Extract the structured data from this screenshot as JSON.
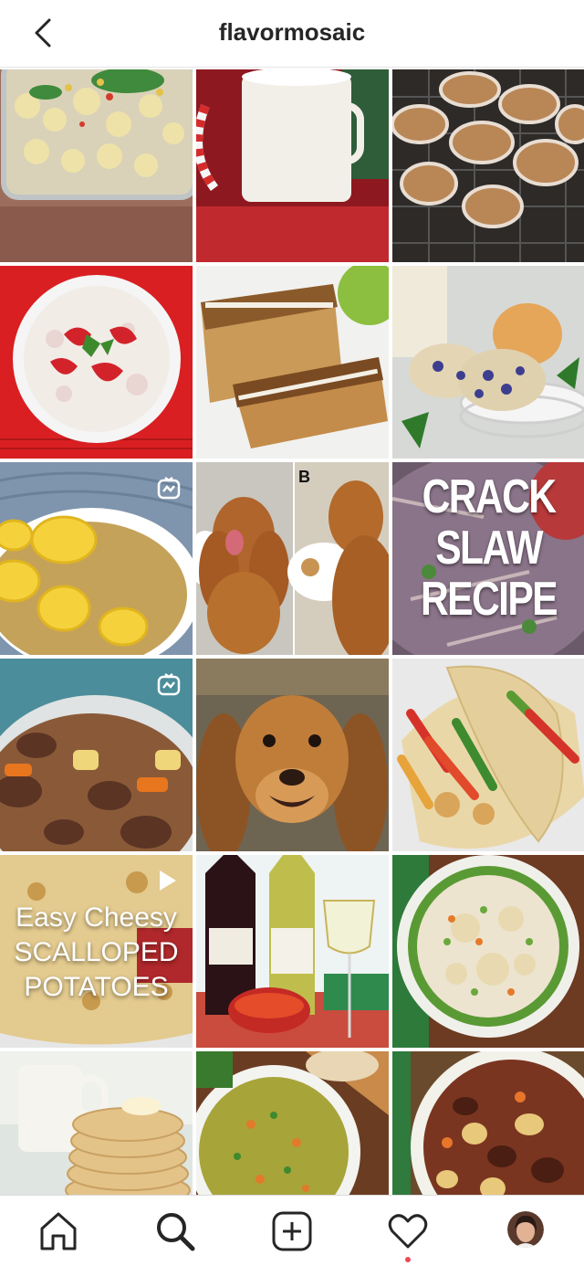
{
  "header": {
    "username": "flavormosaic"
  },
  "tiles": [
    {
      "kind": "photo",
      "subject": "pasta salad casserole"
    },
    {
      "kind": "photo",
      "subject": "hot chocolate mug"
    },
    {
      "kind": "photo",
      "subject": "crinkle cookies on rack"
    },
    {
      "kind": "photo",
      "subject": "strawberry salad bowl"
    },
    {
      "kind": "photo",
      "subject": "coffee cake loaf"
    },
    {
      "kind": "photo",
      "subject": "blueberry muffins"
    },
    {
      "kind": "igtv",
      "subject": "squash casserole"
    },
    {
      "kind": "photo",
      "subject": "dog collage",
      "overlay": "B"
    },
    {
      "kind": "photo",
      "subject": "crack slaw recipe",
      "overlay": "CRACK SLAW RECIPE"
    },
    {
      "kind": "igtv",
      "subject": "beef stew"
    },
    {
      "kind": "photo",
      "subject": "dog portrait"
    },
    {
      "kind": "photo",
      "subject": "chicken fajitas"
    },
    {
      "kind": "video",
      "subject": "scalloped potatoes",
      "overlay_lines": [
        "Easy Cheesy",
        "SCALLOPED",
        "POTATOES"
      ]
    },
    {
      "kind": "photo",
      "subject": "wine and salsa"
    },
    {
      "kind": "photo",
      "subject": "chicken and dumplings"
    },
    {
      "kind": "photo",
      "subject": "pancake stack"
    },
    {
      "kind": "photo",
      "subject": "split pea soup"
    },
    {
      "kind": "photo",
      "subject": "beef and potato stew"
    }
  ],
  "tabs": [
    {
      "icon": "home-icon"
    },
    {
      "icon": "search-icon",
      "active": true
    },
    {
      "icon": "new-post-icon"
    },
    {
      "icon": "heart-icon",
      "notification": true
    },
    {
      "icon": "profile-avatar"
    }
  ],
  "colors": {
    "text": "#262626",
    "divider": "#dbdbdb",
    "notification": "#ed4956"
  }
}
